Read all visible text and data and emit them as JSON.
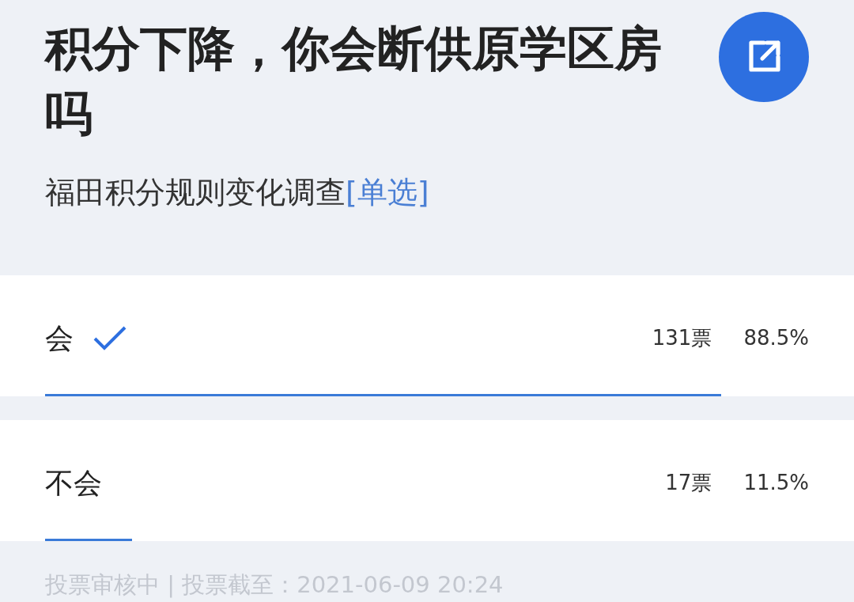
{
  "title": "积分下降，你会断供原学区房吗",
  "subtitle": "福田积分规则变化调查",
  "tag": "[单选]",
  "options": [
    {
      "label": "会",
      "selected": true,
      "votes": "131票",
      "percent": "88.5%",
      "level": 0.885
    },
    {
      "label": "不会",
      "selected": false,
      "votes": "17票",
      "percent": "11.5%",
      "level": 0.114
    }
  ],
  "footer": "投票审核中 | 投票截至：2021-06-09 20:24"
}
